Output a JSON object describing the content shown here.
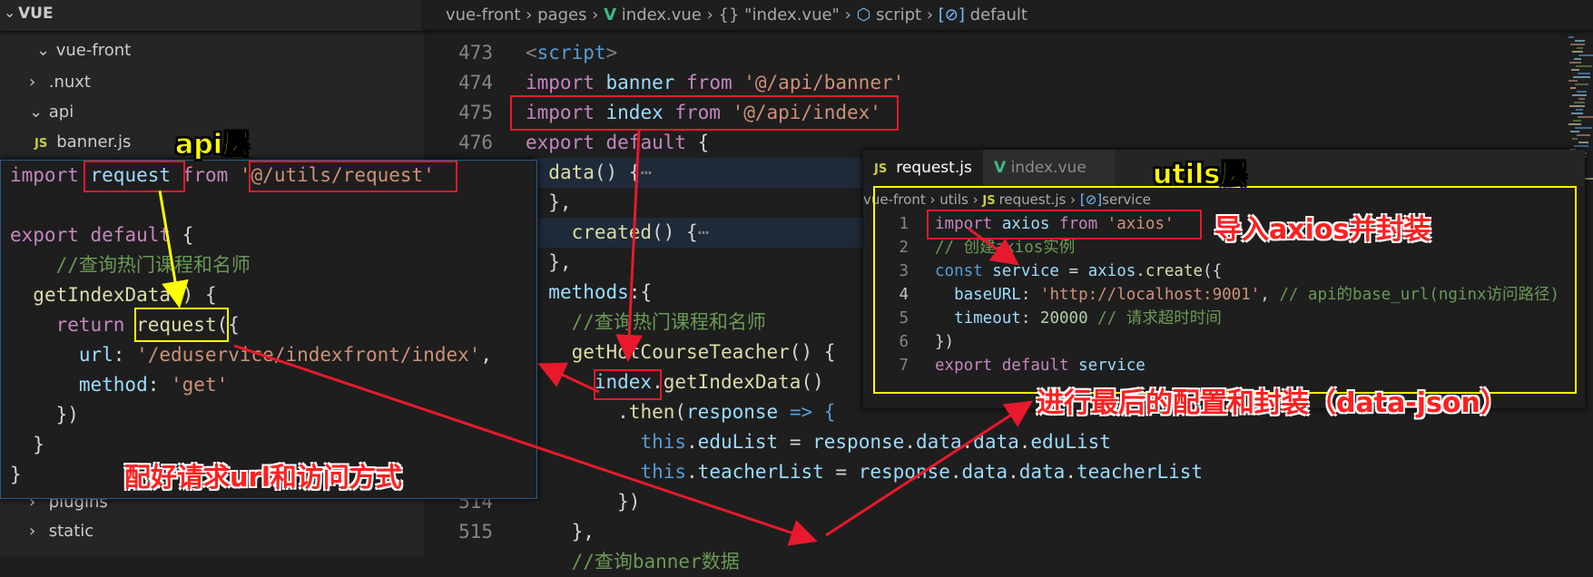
{
  "explorer": {
    "title": "VUE",
    "items": [
      {
        "label": "vue-front",
        "state": "expanded"
      },
      {
        "label": ".nuxt",
        "state": "collapsed"
      },
      {
        "label": "api",
        "state": "expanded"
      },
      {
        "label": "banner.js",
        "icon": "JS"
      },
      {
        "label": "plugins",
        "state": "collapsed"
      },
      {
        "label": "static",
        "state": "collapsed"
      }
    ]
  },
  "breadcrumb": [
    "vue-front",
    "pages",
    "index.vue",
    "{} \"index.vue\"",
    "script",
    "default"
  ],
  "main_editor": {
    "lines": [
      {
        "n": "473",
        "tokens": [
          [
            "<",
            "t"
          ],
          [
            "script",
            "b"
          ],
          [
            ">",
            "t"
          ]
        ]
      },
      {
        "n": "474",
        "tokens": [
          [
            "import ",
            "k"
          ],
          [
            "banner ",
            "v"
          ],
          [
            "from ",
            "k"
          ],
          [
            "'@/api/banner'",
            "s"
          ]
        ]
      },
      {
        "n": "475",
        "tokens": [
          [
            "import ",
            "k"
          ],
          [
            "index ",
            "v"
          ],
          [
            "from ",
            "k"
          ],
          [
            "'@/api/index'",
            "s"
          ]
        ]
      },
      {
        "n": "476",
        "tokens": [
          [
            "export ",
            "k"
          ],
          [
            "default ",
            "k"
          ],
          [
            "{",
            "p"
          ]
        ]
      },
      {
        "n": "",
        "hl": true,
        "tokens": [
          [
            "  ",
            "p"
          ],
          [
            "data",
            "f"
          ],
          [
            "() {",
            "p"
          ],
          [
            "⋯",
            "g"
          ]
        ]
      },
      {
        "n": "",
        "tokens": [
          [
            "  },",
            "p"
          ]
        ]
      },
      {
        "n": "",
        "hl": true,
        "tokens": [
          [
            "    ",
            "p"
          ],
          [
            "created",
            "f"
          ],
          [
            "() {",
            "p"
          ],
          [
            "⋯",
            "g"
          ]
        ]
      },
      {
        "n": "",
        "tokens": [
          [
            "  },",
            "p"
          ]
        ]
      },
      {
        "n": "",
        "tokens": [
          [
            "  ",
            "p"
          ],
          [
            "methods",
            "v"
          ],
          [
            ":{",
            "p"
          ]
        ]
      },
      {
        "n": "",
        "tokens": [
          [
            "    ",
            "p"
          ],
          [
            "//查询热门课程和名师",
            "c"
          ]
        ]
      },
      {
        "n": "",
        "tokens": [
          [
            "    ",
            "p"
          ],
          [
            "getHotCourseTeacher",
            "f"
          ],
          [
            "() {",
            "p"
          ]
        ]
      },
      {
        "n": "",
        "tokens": [
          [
            "      ",
            "p"
          ],
          [
            "index",
            "v"
          ],
          [
            ".",
            "p"
          ],
          [
            "getIndexData",
            "f"
          ],
          [
            "()",
            "p"
          ]
        ]
      },
      {
        "n": "",
        "tokens": [
          [
            "        .",
            "p"
          ],
          [
            "then",
            "f"
          ],
          [
            "(",
            "p"
          ],
          [
            "response",
            "v"
          ],
          [
            " => {",
            "b"
          ]
        ]
      },
      {
        "n": "",
        "tokens": [
          [
            "          ",
            "p"
          ],
          [
            "this",
            "b"
          ],
          [
            ".",
            "p"
          ],
          [
            "eduList",
            "v"
          ],
          [
            " = ",
            "p"
          ],
          [
            "response",
            "v"
          ],
          [
            ".",
            "p"
          ],
          [
            "data",
            "v"
          ],
          [
            ".",
            "p"
          ],
          [
            "data",
            "v"
          ],
          [
            ".",
            "p"
          ],
          [
            "eduList",
            "v"
          ]
        ]
      },
      {
        "n": "",
        "tokens": [
          [
            "          ",
            "p"
          ],
          [
            "this",
            "b"
          ],
          [
            ".",
            "p"
          ],
          [
            "teacherList",
            "v"
          ],
          [
            " = ",
            "p"
          ],
          [
            "response",
            "v"
          ],
          [
            ".",
            "p"
          ],
          [
            "data",
            "v"
          ],
          [
            ".",
            "p"
          ],
          [
            "data",
            "v"
          ],
          [
            ".",
            "p"
          ],
          [
            "teacherList",
            "v"
          ]
        ]
      },
      {
        "n": "514",
        "tokens": [
          [
            "        })",
            "p"
          ]
        ]
      },
      {
        "n": "515",
        "tokens": [
          [
            "    },",
            "p"
          ]
        ]
      },
      {
        "n": "",
        "tokens": [
          [
            "    ",
            "p"
          ],
          [
            "//查询banner数据",
            "c"
          ]
        ]
      }
    ]
  },
  "api_panel": {
    "lines": [
      {
        "tokens": [
          [
            "import ",
            "k"
          ],
          [
            "request ",
            "v"
          ],
          [
            "from ",
            "k"
          ],
          [
            "'@/utils/request'",
            "s"
          ]
        ]
      },
      {
        "tokens": []
      },
      {
        "tokens": [
          [
            "export ",
            "k"
          ],
          [
            "default ",
            "k"
          ],
          [
            "{",
            "p"
          ]
        ]
      },
      {
        "tokens": [
          [
            "    ",
            "p"
          ],
          [
            "//查询热门课程和名师",
            "c"
          ]
        ]
      },
      {
        "tokens": [
          [
            "  ",
            "p"
          ],
          [
            "getIndexData",
            "f"
          ],
          [
            "() {",
            "p"
          ]
        ]
      },
      {
        "tokens": [
          [
            "    ",
            "p"
          ],
          [
            "return ",
            "k"
          ],
          [
            "request",
            "f"
          ],
          [
            "({",
            "p"
          ]
        ]
      },
      {
        "tokens": [
          [
            "      ",
            "p"
          ],
          [
            "url",
            "v"
          ],
          [
            ": ",
            "p"
          ],
          [
            "'/eduservice/indexfront/index'",
            "s"
          ],
          [
            ",",
            "p"
          ]
        ]
      },
      {
        "tokens": [
          [
            "      ",
            "p"
          ],
          [
            "method",
            "v"
          ],
          [
            ": ",
            "p"
          ],
          [
            "'get'",
            "s"
          ]
        ]
      },
      {
        "tokens": [
          [
            "    })",
            "p"
          ]
        ]
      },
      {
        "tokens": [
          [
            "  }",
            "p"
          ]
        ]
      },
      {
        "tokens": [
          [
            "}",
            "p"
          ]
        ]
      }
    ]
  },
  "utils_panel": {
    "tabs": [
      {
        "label": "request.js",
        "icon": "JS",
        "active": true,
        "close": "✕"
      },
      {
        "label": "index.vue",
        "icon": "V",
        "active": false
      }
    ],
    "breadcrumb": [
      "vue-front",
      "utils",
      "request.js",
      "service"
    ],
    "lines": [
      {
        "n": "1",
        "tokens": [
          [
            "import ",
            "k"
          ],
          [
            "axios ",
            "v"
          ],
          [
            "from ",
            "k"
          ],
          [
            "'axios'",
            "s"
          ]
        ]
      },
      {
        "n": "2",
        "tokens": [
          [
            "// 创建axios实例",
            "c"
          ]
        ]
      },
      {
        "n": "3",
        "tokens": [
          [
            "const ",
            "b"
          ],
          [
            "service",
            "v"
          ],
          [
            " = ",
            "p"
          ],
          [
            "axios",
            "v"
          ],
          [
            ".",
            "p"
          ],
          [
            "create",
            "f"
          ],
          [
            "({",
            "p"
          ]
        ]
      },
      {
        "n": "4",
        "current": true,
        "tokens": [
          [
            "  ",
            "p"
          ],
          [
            "baseURL",
            "v"
          ],
          [
            ": ",
            "p"
          ],
          [
            "'http://localhost:9001'",
            "s"
          ],
          [
            ", ",
            "p"
          ],
          [
            "// api的base_url(nginx访问路径)",
            "c"
          ]
        ]
      },
      {
        "n": "5",
        "tokens": [
          [
            "  ",
            "p"
          ],
          [
            "timeout",
            "v"
          ],
          [
            ": ",
            "p"
          ],
          [
            "20000",
            "n"
          ],
          [
            " ",
            "p"
          ],
          [
            "// 请求超时时间",
            "c"
          ]
        ]
      },
      {
        "n": "6",
        "tokens": [
          [
            "})",
            "p"
          ]
        ]
      },
      {
        "n": "7",
        "tokens": [
          [
            "export ",
            "k"
          ],
          [
            "default ",
            "k"
          ],
          [
            "service",
            "v"
          ]
        ]
      }
    ]
  },
  "annotations": {
    "api_layer": "api层",
    "utils_layer": "utils层",
    "import_axios": "导入axios并封装",
    "final_config": "进行最后的配置和封装（data-json）",
    "config_url": "配好请求url和访问方式"
  },
  "colors": {
    "red_annotation": "#e8192c",
    "yellow_annotation": "#ffff00",
    "vue_green": "#41b883",
    "js_yellow": "#cbcb41"
  }
}
